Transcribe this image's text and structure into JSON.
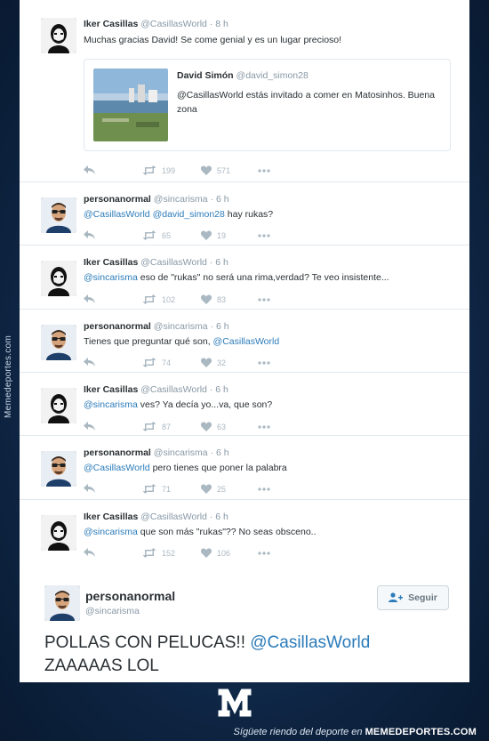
{
  "watermark": "Memedeportes.com",
  "tweets": [
    {
      "name": "Iker Casillas",
      "handle": "@CasillasWorld",
      "time": "· 8 h",
      "prefix": "",
      "mentions": "",
      "text": "Muchas gracias David! Se come genial y es un lugar precioso!",
      "retweets": "199",
      "likes": "571",
      "avatar": "iker"
    },
    {
      "name": "personanormal",
      "handle": "@sincarisma",
      "time": "· 6 h",
      "prefix": "",
      "mentions": "@CasillasWorld @david_simon28",
      "text": " hay rukas?",
      "retweets": "65",
      "likes": "19",
      "avatar": "persona"
    },
    {
      "name": "Iker Casillas",
      "handle": "@CasillasWorld",
      "time": "· 6 h",
      "prefix": "",
      "mentions": "@sincarisma",
      "text": " eso de \"rukas\" no será una rima,verdad? Te veo insistente...",
      "retweets": "102",
      "likes": "83",
      "avatar": "iker"
    },
    {
      "name": "personanormal",
      "handle": "@sincarisma",
      "time": "· 6 h",
      "prefix": "Tienes que preguntar qué son, ",
      "mentions": "@CasillasWorld",
      "text": "",
      "retweets": "74",
      "likes": "32",
      "avatar": "persona"
    },
    {
      "name": "Iker Casillas",
      "handle": "@CasillasWorld",
      "time": "· 6 h",
      "prefix": "",
      "mentions": "@sincarisma",
      "text": " ves? Ya decía yo...va, que son?",
      "retweets": "87",
      "likes": "63",
      "avatar": "iker"
    },
    {
      "name": "personanormal",
      "handle": "@sincarisma",
      "time": "· 6 h",
      "prefix": "",
      "mentions": "@CasillasWorld",
      "text": " pero tienes que poner la palabra",
      "retweets": "71",
      "likes": "25",
      "avatar": "persona"
    },
    {
      "name": "Iker Casillas",
      "handle": "@CasillasWorld",
      "time": "· 6 h",
      "prefix": "",
      "mentions": "@sincarisma",
      "text": " que son más \"rukas\"?? No seas obsceno..",
      "retweets": "152",
      "likes": "106",
      "avatar": "iker"
    }
  ],
  "quote": {
    "name": "David Simón",
    "handle": "@david_simon28",
    "text": "@CasillasWorld estás invitado a comer en Matosinhos. Buena zona"
  },
  "featured": {
    "name": "personanormal",
    "handle": "@sincarisma",
    "follow_label": "Seguir",
    "text_before": "POLLAS CON PELUCAS!! ",
    "mention": "@CasillasWorld",
    "text_after": "ZAAAAAS LOL"
  },
  "footer": {
    "text": "Sígüete riendo del deporte en ",
    "brand": "MEMEDEPORTES.COM"
  },
  "colors": {
    "link": "#2b7bb9",
    "name": "#292f33",
    "meta": "#8899a6",
    "icons": "#aab8c2"
  }
}
